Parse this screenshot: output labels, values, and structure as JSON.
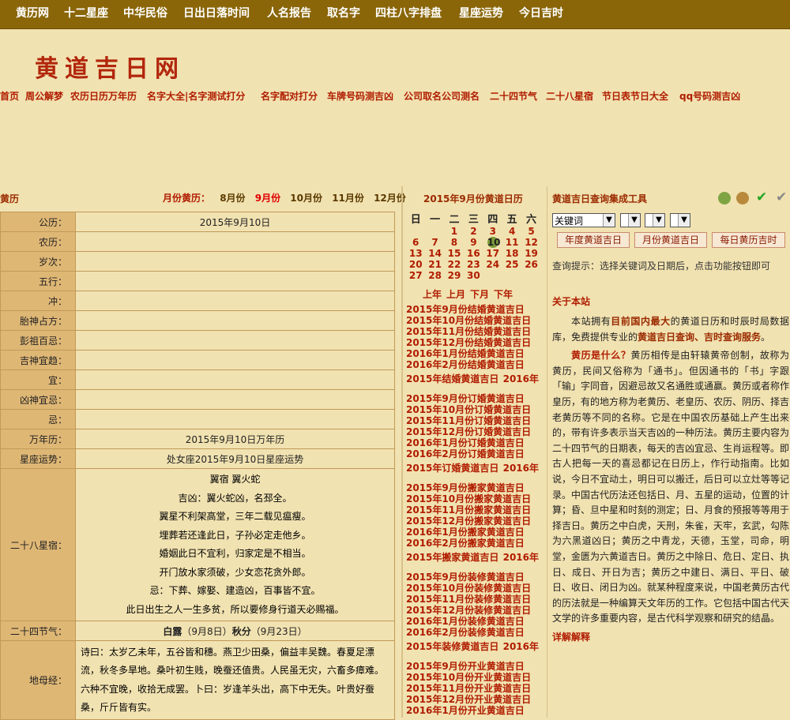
{
  "top_nav": [
    "黄历网",
    "十二星座",
    "中华民俗",
    "日出日落时间",
    "人名报告",
    "取名字",
    "四柱八字排盘",
    "星座运势",
    "今日吉时"
  ],
  "logo": "黄道吉日网",
  "sub_nav": [
    "首页",
    "周公解梦",
    "农历日历万年历",
    "名字大全|名字测试打分",
    "名字配对打分",
    "车牌号码测吉凶",
    "公司取名公司测名",
    "二十四节气",
    "二十八星宿",
    "节日表节日大全",
    "qq号码测吉凶"
  ],
  "left": {
    "title": "黄历",
    "month_label": "月份黄历：",
    "months": [
      "8月份",
      "9月份",
      "10月份",
      "11月份",
      "12月份"
    ],
    "current_month": "9月份"
  },
  "rows": [
    {
      "k": "公历：",
      "v": "2015年9月10日"
    },
    {
      "k": "农历：",
      "v": ""
    },
    {
      "k": "岁次：",
      "v": ""
    },
    {
      "k": "五行：",
      "v": ""
    },
    {
      "k": "冲：",
      "v": ""
    },
    {
      "k": "胎神占方：",
      "v": ""
    },
    {
      "k": "彭祖百忌：",
      "v": ""
    },
    {
      "k": "吉神宜趋：",
      "v": ""
    },
    {
      "k": "宜：",
      "v": ""
    },
    {
      "k": "凶神宜忌：",
      "v": ""
    },
    {
      "k": "忌：",
      "v": ""
    },
    {
      "k": "万年历：",
      "v": "2015年9月10日万年历"
    },
    {
      "k": "星座运势：",
      "v": "处女座2015年9月10日星座运势"
    }
  ],
  "xiu": {
    "k": "二十八星宿：",
    "lines": [
      "翼宿 翼火蛇",
      "吉凶：翼火蛇凶，名邳全。",
      "翼星不利架高堂，三年二载见瘟瘦。",
      "埋葬若还逢此日，子孙必定走他乡。",
      "婚姻此日不宜利，归家定是不相当。",
      "开门放水家须破，少女恋花贪外郎。",
      "忌：下葬、嫁娶、建造凶，百事皆不宜。",
      "此日出生之人一生多贫，所以要修身行道天必赐福。"
    ]
  },
  "jieqi": {
    "k": "二十四节气：",
    "a": "白露",
    "a_date": "（9月8日）",
    "b": "秋分",
    "b_date": "（9月23日）"
  },
  "dimu": {
    "k": "地母经：",
    "text": "诗曰：太岁乙未年，五谷皆和穗。燕卫少田桑，偏益丰吴魏。春夏足漂流，秋冬多旱地。桑叶初生贱，晚蚕还值贵。人民虽无灾，六畜多瘴难。六种不宜晚，收拾无成罢。卜曰：岁逢羊头出，高下中无失。叶贵好蚕桑，斤斤皆有实。"
  },
  "calendar": {
    "title": "2015年9月份黄道日历",
    "dow": [
      "日",
      "一",
      "二",
      "三",
      "四",
      "五",
      "六"
    ],
    "weeks": [
      [
        "",
        "",
        "1",
        "2",
        "3",
        "4",
        "5"
      ],
      [
        "6",
        "7",
        "8",
        "9",
        "10",
        "11",
        "12"
      ],
      [
        "13",
        "14",
        "15",
        "16",
        "17",
        "18",
        "19"
      ],
      [
        "20",
        "21",
        "22",
        "23",
        "24",
        "25",
        "26"
      ],
      [
        "27",
        "28",
        "29",
        "30",
        "",
        "",
        ""
      ]
    ],
    "today": "10",
    "nav": [
      "上年",
      "上月",
      "下月",
      "下年"
    ]
  },
  "link_groups": [
    {
      "links": [
        "2015年9月份结婚黄道吉日",
        "2015年10月份结婚黄道吉日",
        "2015年11月份结婚黄道吉日",
        "2015年12月份结婚黄道吉日",
        "2016年1月份结婚黄道吉日",
        "2016年2月份结婚黄道吉日"
      ],
      "sum": "2015年结婚黄道吉日",
      "sum2": "2016年"
    },
    {
      "links": [
        "2015年9月份订婚黄道吉日",
        "2015年10月份订婚黄道吉日",
        "2015年11月份订婚黄道吉日",
        "2015年12月份订婚黄道吉日",
        "2016年1月份订婚黄道吉日",
        "2016年2月份订婚黄道吉日"
      ],
      "sum": "2015年订婚黄道吉日",
      "sum2": "2016年"
    },
    {
      "links": [
        "2015年9月份搬家黄道吉日",
        "2015年10月份搬家黄道吉日",
        "2015年11月份搬家黄道吉日",
        "2015年12月份搬家黄道吉日",
        "2016年1月份搬家黄道吉日",
        "2016年2月份搬家黄道吉日"
      ],
      "sum": "2015年搬家黄道吉日",
      "sum2": "2016年"
    },
    {
      "links": [
        "2015年9月份装修黄道吉日",
        "2015年10月份装修黄道吉日",
        "2015年11月份装修黄道吉日",
        "2015年12月份装修黄道吉日",
        "2016年1月份装修黄道吉日",
        "2016年2月份装修黄道吉日"
      ],
      "sum": "2015年装修黄道吉日",
      "sum2": "2016年"
    },
    {
      "links": [
        "2015年9月份开业黄道吉日",
        "2015年10月份开业黄道吉日",
        "2015年11月份开业黄道吉日",
        "2015年12月份开业黄道吉日",
        "2016年1月份开业黄道吉日"
      ],
      "sum": "",
      "sum2": ""
    }
  ],
  "tools": {
    "title": "黄道吉日查询集成工具",
    "keyword_select": "关键词",
    "buttons": [
      "年度黄道吉日",
      "月份黄道吉日",
      "每日黄历吉时"
    ],
    "hint": "查询提示：选择关键词及日期后，点击功能按钮即可"
  },
  "about": {
    "title": "关于本站",
    "p1_a": "本站拥有",
    "p1_b": "目前国内最大",
    "p1_c": "的黄道日历和时辰时局数据库，免费提供专业的",
    "p1_d": "黄道吉日查询、吉时查询服务",
    "p1_e": "。",
    "p2_lead": "黄历是什么？",
    "p2": "黄历相传是由轩辕黄帝创制，故称为黄历，民间又俗称为「通书」。但因通书的「书」字跟「输」字同音，因避忌故又名通胜或通赢。黄历或者称作皇历，有的地方称为老黄历、老皇历、农历、阴历、择吉老黄历等不同的名称。它是在中国农历基础上产生出来的，带有许多表示当天吉凶的一种历法。黄历主要内容为二十四节气的日期表，每天的吉凶宜忌、生肖运程等。即古人把每一天的喜忌都记在日历上，作行动指南。比如说，今日不宜动土，明日可以搬迁，后日可以立灶等等记录。中国古代历法还包括日、月、五星的运动，位置的计算；昏、旦中星和时刻的测定；日、月食的预报等等用于择吉日。黄历之中白虎，天刑，朱雀，天牢，玄武，勾陈为六黑道凶日；黄历之中青龙，天德，玉堂，司命，明堂，金匮为六黄道吉日。黄历之中除日、危日、定日、执日、成日、开日为吉；黄历之中建日、满日、平日、破日、收日、闭日为凶。就某种程度来说，中国老黄历古代的历法就是一种编算天文年历的工作。它包括中国古代天文学的许多重要内容，是古代科学观察和研究的结晶。",
    "more": "详解解释"
  },
  "colors": {
    "nav_bg": "#8a6608",
    "page_bg": "#f1e2b1",
    "accent": "#b01c00",
    "cell_key_bg": "#dfb775"
  }
}
